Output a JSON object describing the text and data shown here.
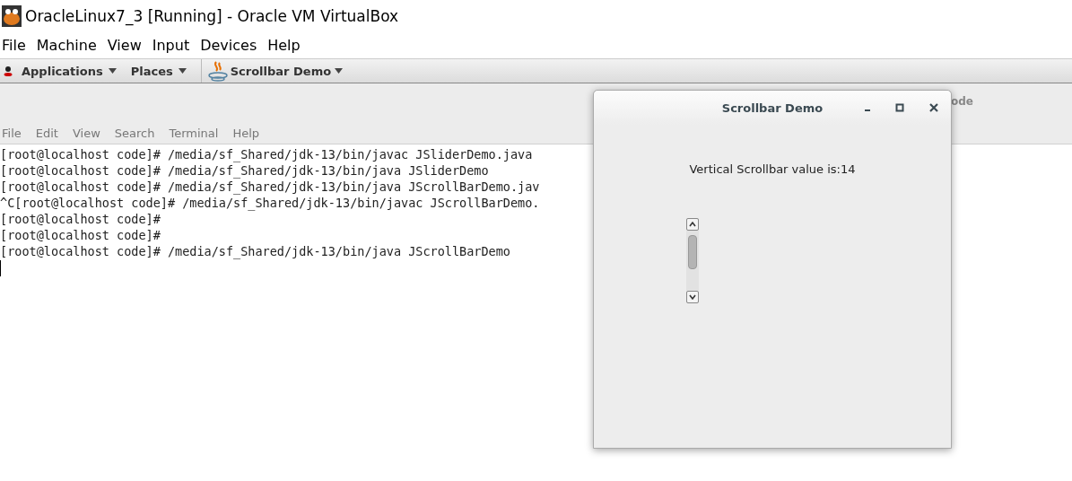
{
  "window": {
    "title": "OracleLinux7_3 [Running] - Oracle VM VirtualBox"
  },
  "menu": [
    "File",
    "Machine",
    "View",
    "Input",
    "Devices",
    "Help"
  ],
  "top_bar": {
    "items": [
      {
        "label": "Applications"
      },
      {
        "label": "Places"
      }
    ],
    "app_menu": {
      "label": "Scrollbar Demo"
    }
  },
  "terminal": {
    "title": "ode",
    "menu": [
      "File",
      "Edit",
      "View",
      "Search",
      "Terminal",
      "Help"
    ],
    "lines": [
      "[root@localhost code]# /media/sf_Shared/jdk-13/bin/javac JSliderDemo.java",
      "[root@localhost code]# /media/sf_Shared/jdk-13/bin/java JSliderDemo",
      "[root@localhost code]# /media/sf_Shared/jdk-13/bin/java JScrollBarDemo.jav",
      "^C[root@localhost code]# /media/sf_Shared/jdk-13/bin/javac JScrollBarDemo.",
      "[root@localhost code]#",
      "[root@localhost code]#",
      "[root@localhost code]# /media/sf_Shared/jdk-13/bin/java JScrollBarDemo"
    ]
  },
  "dialog": {
    "title": "Scrollbar Demo",
    "label": "Vertical Scrollbar value is:14"
  }
}
